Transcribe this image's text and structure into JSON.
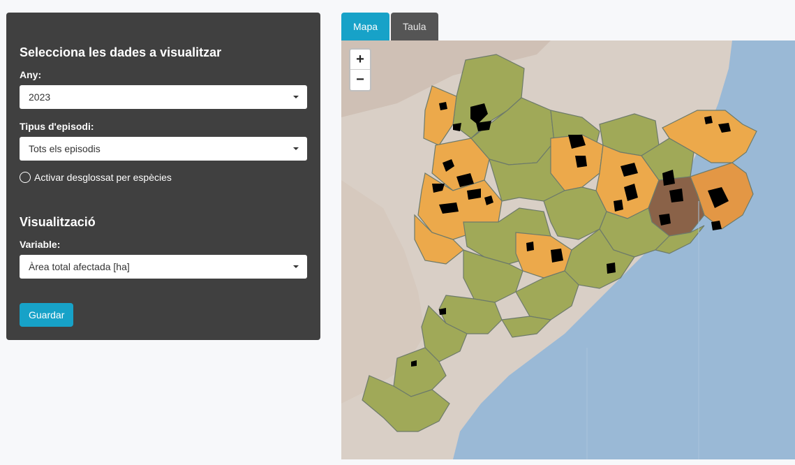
{
  "sidebar": {
    "section1_title": "Selecciona les dades a visualitzar",
    "year_label": "Any:",
    "year_value": "2023",
    "episode_label": "Tipus d'episodi:",
    "episode_value": "Tots els episodis",
    "species_toggle_label": "Activar desglossat per espècies",
    "section2_title": "Visualització",
    "variable_label": "Variable:",
    "variable_value": "Àrea total afectada [ha]",
    "save_label": "Guardar"
  },
  "tabs": [
    {
      "label": "Mapa",
      "active": true
    },
    {
      "label": "Taula",
      "active": false
    }
  ],
  "map": {
    "zoom_in_label": "+",
    "zoom_out_label": "−",
    "colors": {
      "sea": "#9ab9d6",
      "land_relief": "#d9cfc6",
      "low": "#a0a958",
      "medium": "#eca94b",
      "high": "#e39745",
      "highest": "#8a6248",
      "outline": "#6d7a6a",
      "affected_area": "#000000"
    }
  },
  "colors": {
    "sidebar_bg": "#404040",
    "accent": "#17a2c8",
    "inactive_tab": "#555555"
  }
}
